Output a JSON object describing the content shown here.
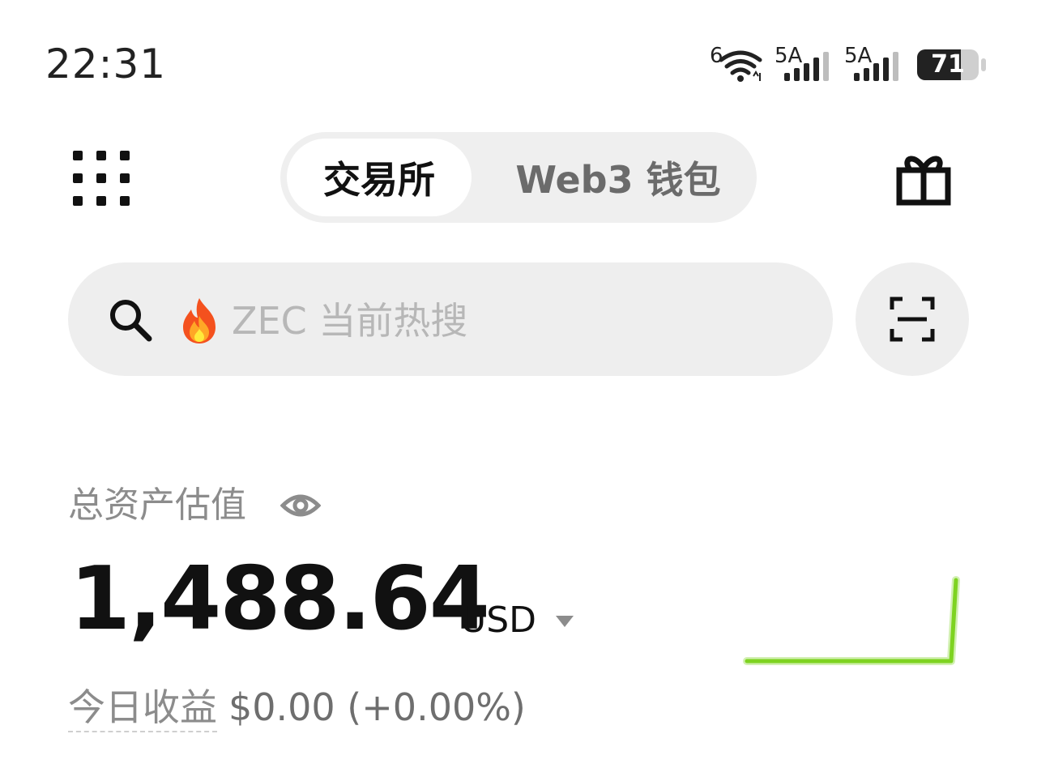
{
  "status_bar": {
    "time": "22:31",
    "wifi_tag": "6",
    "signal1_tag": "5A",
    "signal2_tag": "5A",
    "battery_percent": "71",
    "icons": [
      "wifi-icon",
      "cell-signal-icon",
      "cell-signal-icon",
      "battery-icon"
    ]
  },
  "header": {
    "menu_icon": "grid-menu-icon",
    "tabs": [
      {
        "label": "交易所",
        "active": true
      },
      {
        "label": "Web3 钱包",
        "active": false
      }
    ],
    "gift_icon": "gift-icon"
  },
  "search": {
    "icon": "search-icon",
    "hot_icon": "fire-icon",
    "placeholder": "ZEC 当前热搜",
    "scan_icon": "scan-icon"
  },
  "assets": {
    "label": "总资产估值",
    "visibility_icon": "eye-icon",
    "balance": "1,488.64",
    "currency": "USD",
    "today_pnl_label": "今日收益",
    "today_pnl_value": "$0.00 (+0.00%)"
  },
  "colors": {
    "accent_green": "#7ed321",
    "segment_bg": "#efefef",
    "muted_text": "#8c8c8c"
  }
}
